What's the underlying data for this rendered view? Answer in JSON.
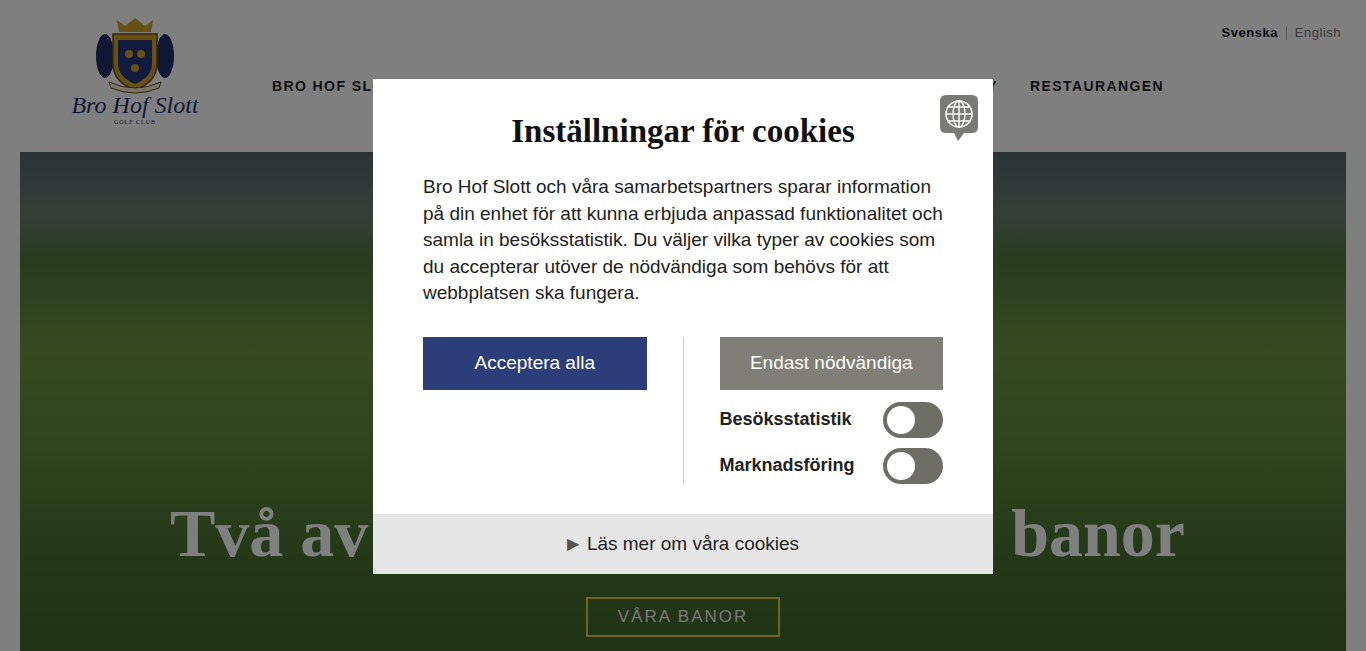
{
  "header": {
    "logo": {
      "name": "Bro Hof Slott",
      "tagline": "GOLF CLUB"
    },
    "nav": [
      {
        "label": "BRO HOF SLO"
      },
      {
        "label": "MY"
      },
      {
        "label": "RESTAURANGEN"
      }
    ],
    "languages": [
      {
        "label": "Svenska",
        "selected": true
      },
      {
        "label": "English",
        "selected": false
      }
    ]
  },
  "hero": {
    "title_parts": [
      "Två av",
      "banor"
    ],
    "button": "VÅRA BANOR"
  },
  "cookie_dialog": {
    "title": "Inställningar för cookies",
    "text": "Bro Hof Slott och våra samarbetspartners sparar information på din enhet för att kunna erbjuda anpassad funktionalitet och samla in besöksstatistik. Du väljer vilka typer av cookies som du accepterar utöver de nödvändiga som behövs för att webbplatsen ska fungera.",
    "accept_all": "Acceptera alla",
    "necessary_only": "Endast nödvändiga",
    "toggles": [
      {
        "label": "Besöksstatistik",
        "on": false
      },
      {
        "label": "Marknadsföring",
        "on": false
      }
    ],
    "read_more": {
      "icon": "▶",
      "label": "Läs mer om våra cookies"
    }
  }
}
